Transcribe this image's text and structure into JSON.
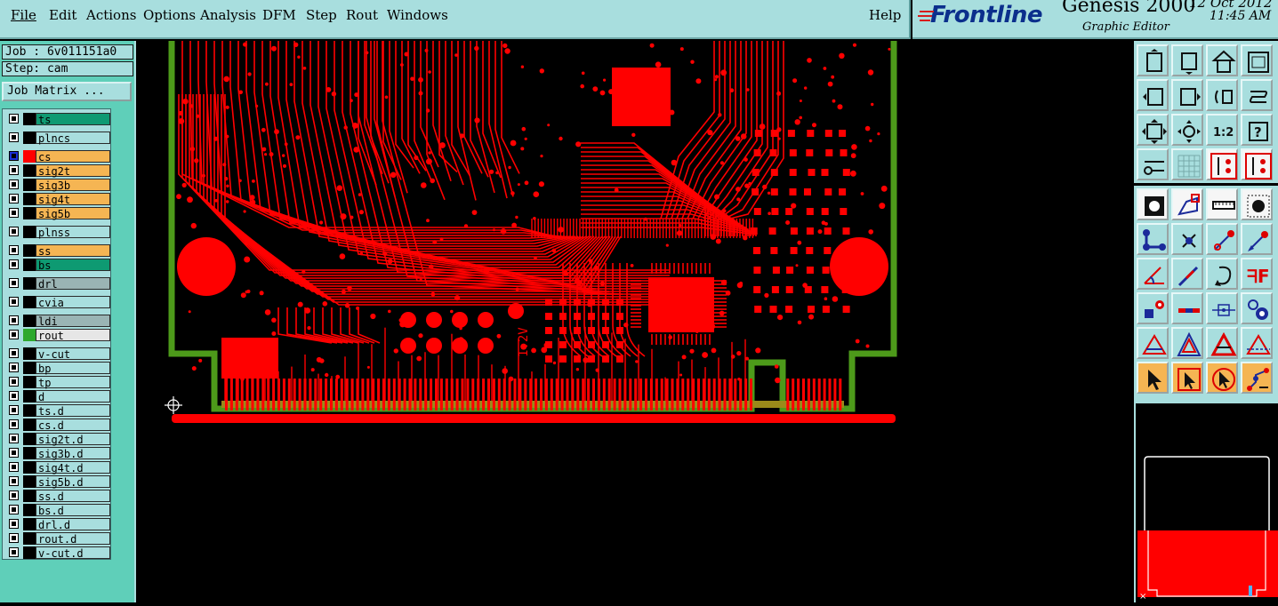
{
  "menu": {
    "items": [
      "File",
      "Edit",
      "Actions",
      "Options",
      "Analysis",
      "DFM",
      "Step",
      "Rout",
      "Windows"
    ],
    "help": "Help"
  },
  "brand": {
    "logo": "Frontline",
    "title": "Genesis 2000",
    "subtitle": "Graphic Editor",
    "date": "12 Oct 2012",
    "time": "11:45 AM"
  },
  "job": {
    "job_label": "Job : 6v011151a0",
    "step_label": "Step: cam",
    "matrix_button": "Job Matrix ..."
  },
  "layers": [
    {
      "name": "ts",
      "color": "#0e9a72"
    },
    {
      "name": "plncs",
      "color": "#a8dede"
    },
    {
      "name": "cs",
      "color": "#f5b553",
      "active": true
    },
    {
      "name": "sig2t",
      "color": "#f5b553"
    },
    {
      "name": "sig3b",
      "color": "#f5b553"
    },
    {
      "name": "sig4t",
      "color": "#f5b553"
    },
    {
      "name": "sig5b",
      "color": "#f5b553"
    },
    {
      "name": "plnss",
      "color": "#a8dede"
    },
    {
      "name": "ss",
      "color": "#f5b553"
    },
    {
      "name": "bs",
      "color": "#0e9a72"
    },
    {
      "name": "drl",
      "color": "#9ab4b4"
    },
    {
      "name": "cvia",
      "color": "#a8dede"
    },
    {
      "name": "ldi",
      "color": "#9ab4b4"
    },
    {
      "name": "rout",
      "color": "#e6e6e6",
      "swatch": "#2ea82e"
    },
    {
      "name": "v-cut",
      "color": "#a8dede"
    },
    {
      "name": "bp",
      "color": "#a8dede"
    },
    {
      "name": "tp",
      "color": "#a8dede"
    },
    {
      "name": "d",
      "color": "#a8dede"
    },
    {
      "name": "ts.d",
      "color": "#a8dede"
    },
    {
      "name": "cs.d",
      "color": "#a8dede"
    },
    {
      "name": "sig2t.d",
      "color": "#a8dede"
    },
    {
      "name": "sig3b.d",
      "color": "#a8dede"
    },
    {
      "name": "sig4t.d",
      "color": "#a8dede"
    },
    {
      "name": "sig5b.d",
      "color": "#a8dede"
    },
    {
      "name": "ss.d",
      "color": "#a8dede"
    },
    {
      "name": "bs.d",
      "color": "#a8dede"
    },
    {
      "name": "drl.d",
      "color": "#a8dede"
    },
    {
      "name": "rout.d",
      "color": "#a8dede"
    },
    {
      "name": "v-cut.d",
      "color": "#a8dede"
    }
  ],
  "pcb": {
    "silk_label": "1.2V",
    "trace_color": "#ff0000",
    "outline_color": "#4d9a1a"
  },
  "toolbar": {
    "zoom_label": "1:2",
    "help_icon": "?"
  }
}
